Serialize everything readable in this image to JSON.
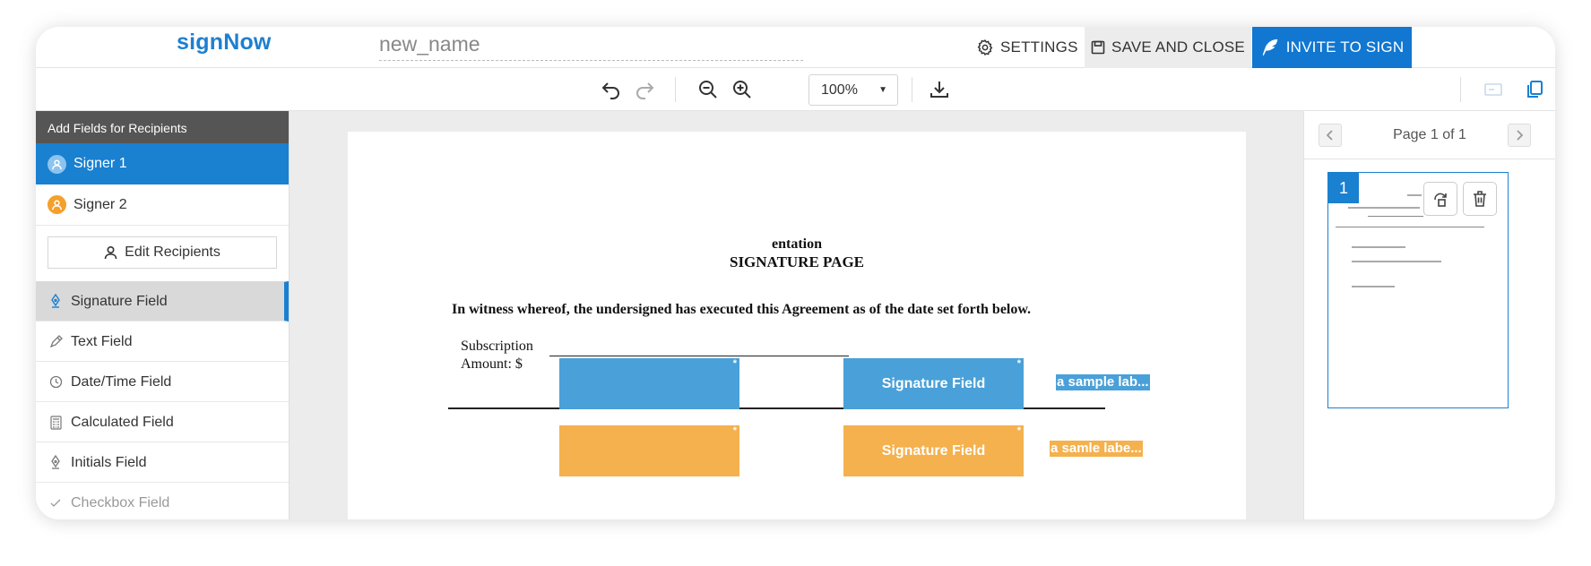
{
  "header": {
    "logo": "signNow",
    "document_name": "new_name",
    "settings_label": "SETTINGS",
    "save_close_label": "SAVE AND CLOSE",
    "invite_label": "INVITE TO SIGN"
  },
  "toolbar": {
    "zoom_value": "100%",
    "icons": [
      "undo-icon",
      "redo-icon",
      "zoom-out-icon",
      "zoom-in-icon",
      "download-icon",
      "fields-icon",
      "copy-icon"
    ]
  },
  "sidebar": {
    "heading": "Add Fields for Recipients",
    "signers": [
      {
        "label": "Signer 1",
        "color": "#1a80d0"
      },
      {
        "label": "Signer 2",
        "color": "#f4a02a"
      }
    ],
    "edit_recipients_label": "Edit Recipients",
    "fields": [
      {
        "label": "Signature Field",
        "icon": "pen-nib-icon"
      },
      {
        "label": "Text Field",
        "icon": "pencil-icon"
      },
      {
        "label": "Date/Time Field",
        "icon": "clock-icon"
      },
      {
        "label": "Calculated Field",
        "icon": "calculator-icon"
      },
      {
        "label": "Initials Field",
        "icon": "pen-nib-icon"
      },
      {
        "label": "Checkbox Field",
        "icon": "checkbox-icon"
      }
    ]
  },
  "document": {
    "title_line1": "entation",
    "title_line2": "SIGNATURE PAGE",
    "paragraph": "In witness whereof, the undersigned has executed this Agreement as of the date set forth below.",
    "subscription_line1": "Subscription",
    "subscription_line2": "Amount: $",
    "fields": {
      "blue_signature": "Signature Field",
      "orange_signature": "Signature Field",
      "blue_label": "a sample lab...",
      "orange_label": "a samle labe...",
      "required_mark": "*"
    }
  },
  "right_panel": {
    "page_label": "Page  1 of 1",
    "thumbnail_number": "1"
  },
  "colors": {
    "accent": "#1a80d0",
    "signer1": "#4aa0d8",
    "signer2": "#f4b14d"
  }
}
